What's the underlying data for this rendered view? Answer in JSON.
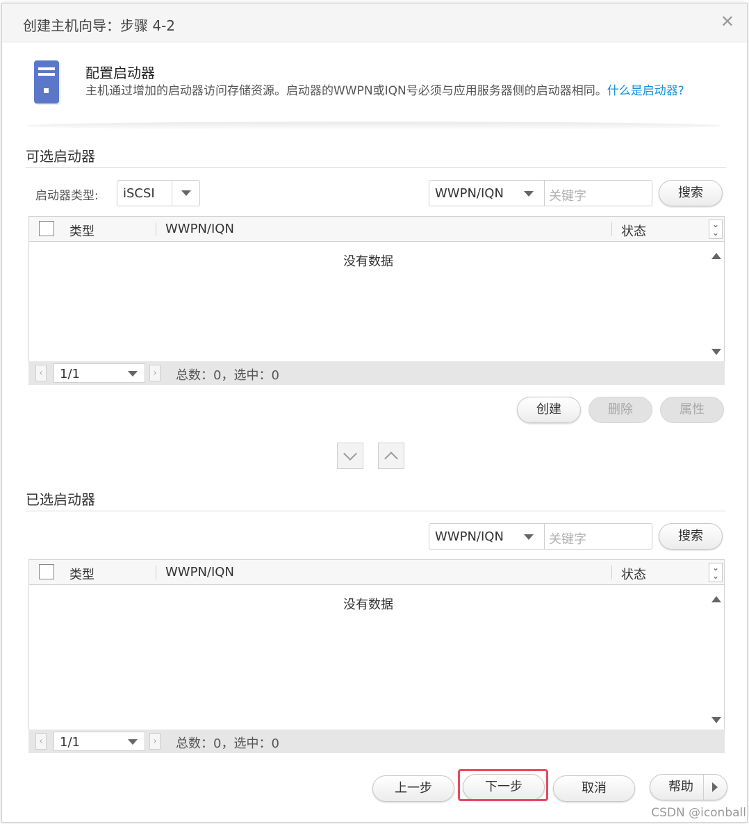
{
  "dialog": {
    "title": "创建主机向导：步骤 4-2",
    "close_glyph": "✕"
  },
  "header": {
    "title": "配置启动器",
    "description": "主机通过增加的启动器访问存储资源。启动器的WWPN或IQN号必须与应用服务器侧的启动器相同。",
    "link": "什么是启动器?"
  },
  "available": {
    "section_title": "可选启动器",
    "type_label": "启动器类型:",
    "type_value": "iSCSI",
    "search_field": "WWPN/IQN",
    "search_placeholder": "关键字",
    "search_button": "搜索",
    "columns": [
      "类型",
      "WWPN/IQN",
      "状态"
    ],
    "empty_text": "没有数据",
    "page": "1/1",
    "total": "总数：0，选中：0",
    "buttons": {
      "create": "创建",
      "delete": "删除",
      "properties": "属性"
    }
  },
  "selected": {
    "section_title": "已选启动器",
    "search_field": "WWPN/IQN",
    "search_placeholder": "关键字",
    "search_button": "搜索",
    "columns": [
      "类型",
      "WWPN/IQN",
      "状态"
    ],
    "empty_text": "没有数据",
    "page": "1/1",
    "total": "总数：0，选中：0"
  },
  "footer": {
    "prev": "上一步",
    "next": "下一步",
    "cancel": "取消",
    "help": "帮助"
  },
  "watermark": "CSDN @iconball",
  "colors": {
    "link": "#1a8fd6",
    "highlight": "#e84a5f",
    "server_icon": "#5b78c8"
  }
}
